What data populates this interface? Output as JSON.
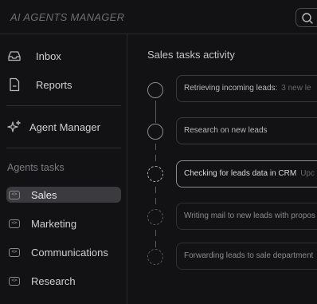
{
  "app": {
    "title": "AI AGENTS MANAGER"
  },
  "sidebar": {
    "nav": [
      {
        "label": "Inbox",
        "icon": "inbox-icon"
      },
      {
        "label": "Reports",
        "icon": "document-icon"
      },
      {
        "label": "Agent Manager",
        "icon": "sparkles-icon"
      }
    ],
    "section_label": "Agents tasks",
    "tasks": [
      {
        "label": "Sales",
        "icon": "code-icon"
      },
      {
        "label": "Marketing",
        "icon": "code-icon"
      },
      {
        "label": "Communications",
        "icon": "code-icon"
      },
      {
        "label": "Research",
        "icon": "code-icon"
      }
    ],
    "task_icon_glyph": "<>"
  },
  "main": {
    "title": "Sales tasks activity",
    "steps": [
      {
        "text": "Retrieving incoming leads:",
        "extra": "3 new le",
        "state": "done"
      },
      {
        "text": "Research on new leads",
        "extra": "",
        "state": "done"
      },
      {
        "text": "Checking for leads data in CRM",
        "extra": "Upc",
        "state": "in-progress"
      },
      {
        "text": "Writing mail to new leads with propos",
        "extra": "",
        "state": "pending"
      },
      {
        "text": "Forwarding leads to sale department",
        "extra": "",
        "state": "pending"
      }
    ]
  },
  "colors": {
    "background": "#121214",
    "border": "#2a2a2e",
    "active_item": "#3a3a3f"
  }
}
